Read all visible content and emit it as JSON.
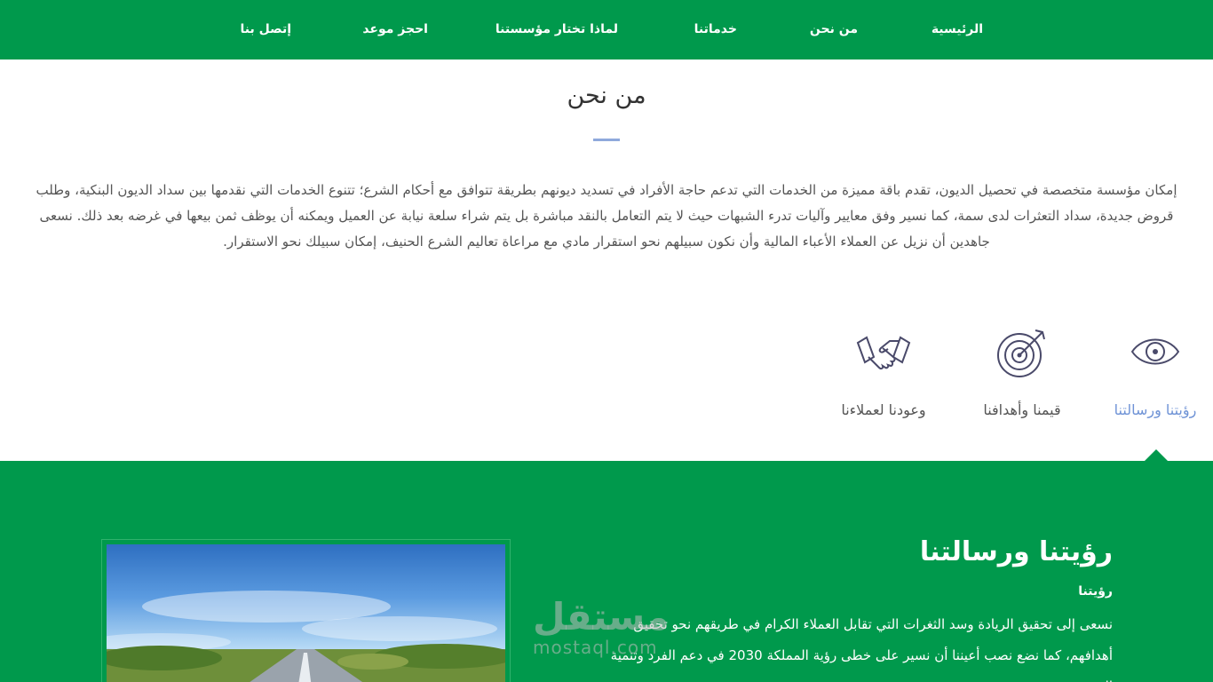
{
  "nav": {
    "items": [
      {
        "label": "الرئيسية"
      },
      {
        "label": "من نحن"
      },
      {
        "label": "خدماتنا"
      },
      {
        "label": "لماذا تختار مؤسستنا"
      },
      {
        "label": "احجز موعد"
      },
      {
        "label": "إتصل بنا"
      }
    ]
  },
  "about": {
    "title": "من نحن",
    "text": "إمكان مؤسسة متخصصة في تحصيل الديون، تقدم باقة مميزة من الخدمات التي تدعم حاجة الأفراد في تسديد ديونهم بطريقة تتوافق مع أحكام الشرع؛ تتنوع الخدمات التي نقدمها بين سداد الديون البنكية، وطلب قروض جديدة، سداد التعثرات لدى سمة، كما نسير وفق معايير وآليات تدرء الشبهات حيث لا يتم التعامل بالنقد مباشرة بل يتم شراء سلعة نيابة عن العميل ويمكنه أن يوظف ثمن بيعها في غرضه بعد ذلك. نسعى جاهدين أن نزيل عن العملاء الأعباء المالية وأن نكون سبيلهم نحو استقرار مادي مع مراعاة تعاليم الشرع الحنيف، إمكان سبيلك نحو الاستقرار."
  },
  "features": [
    {
      "label": "رؤيتنا ورسالتنا",
      "icon": "eye-icon",
      "active": true
    },
    {
      "label": "قيمنا وأهدافنا",
      "icon": "target-icon",
      "active": false
    },
    {
      "label": "وعودنا لعملاءنا",
      "icon": "handshake-icon",
      "active": false
    }
  ],
  "vision": {
    "heading": "رؤيتنا ورسالتنا",
    "subheading": "رؤيتنا",
    "text": "نسعى إلى تحقيق الريادة وسد الثغرات التي تقابل العملاء الكرام في طريقهم نحو تحقيق أهدافهم، كما نضع نصب أعيننا أن نسير على خطى رؤية المملكة 2030 في دعم الفرد وتنمية المجتمع"
  },
  "watermark": {
    "logo": "مستقل",
    "url": "mostaql.com"
  },
  "colors": {
    "brand_green": "#00994c",
    "accent_blue": "#6f93d6",
    "icon_stroke": "#4a4a6a"
  }
}
